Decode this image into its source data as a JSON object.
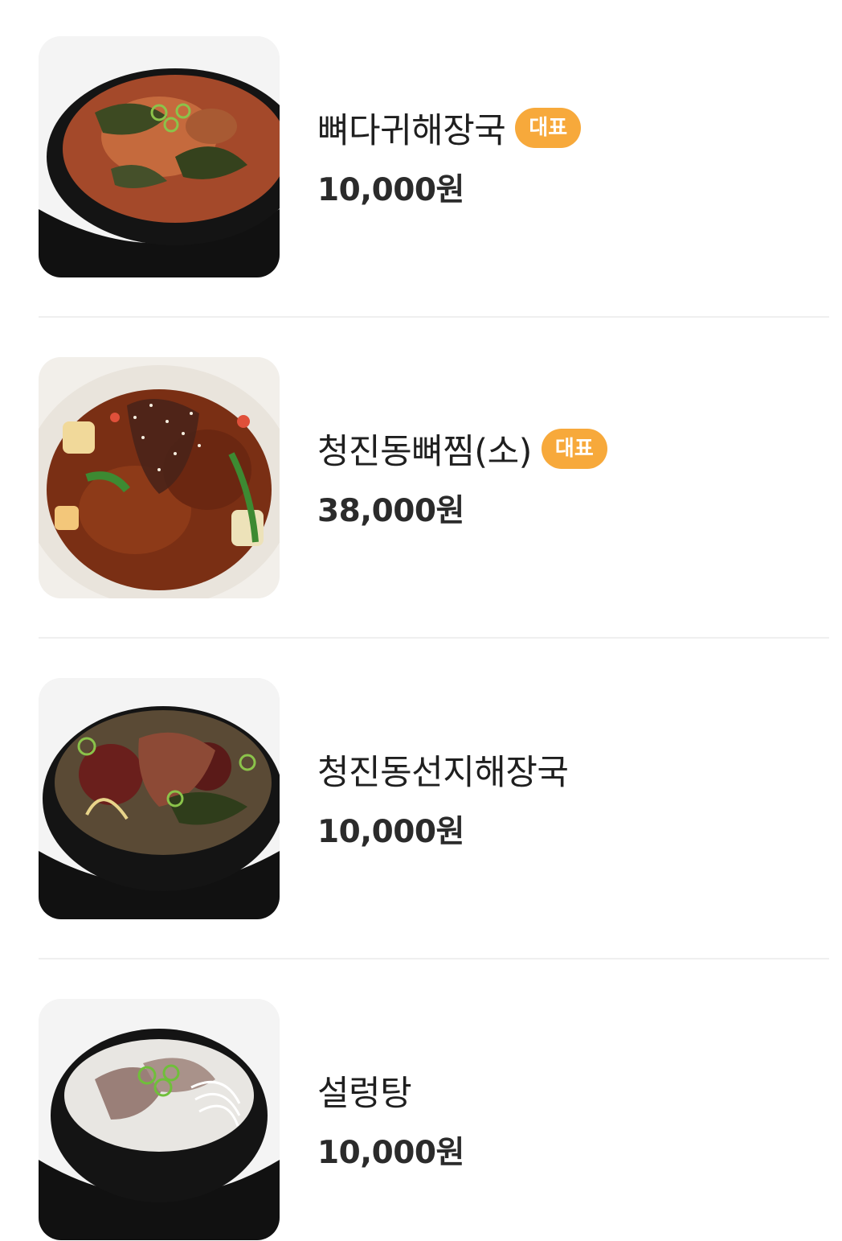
{
  "menu": {
    "items": [
      {
        "name": "뼈다귀해장국",
        "badge": "대표",
        "price": "10,000원",
        "image_icon": "pork-bone-soup-image"
      },
      {
        "name": "청진동뼈찜(소)",
        "badge": "대표",
        "price": "38,000원",
        "image_icon": "braised-pork-bone-image"
      },
      {
        "name": "청진동선지해장국",
        "badge": "",
        "price": "10,000원",
        "image_icon": "blood-sausage-soup-image"
      },
      {
        "name": "설렁탕",
        "badge": "",
        "price": "10,000원",
        "image_icon": "ox-bone-soup-image"
      }
    ]
  },
  "colors": {
    "badge_bg": "#f7a93b",
    "badge_text": "#ffffff",
    "divider": "#efefef",
    "text": "#1f1f1f"
  }
}
